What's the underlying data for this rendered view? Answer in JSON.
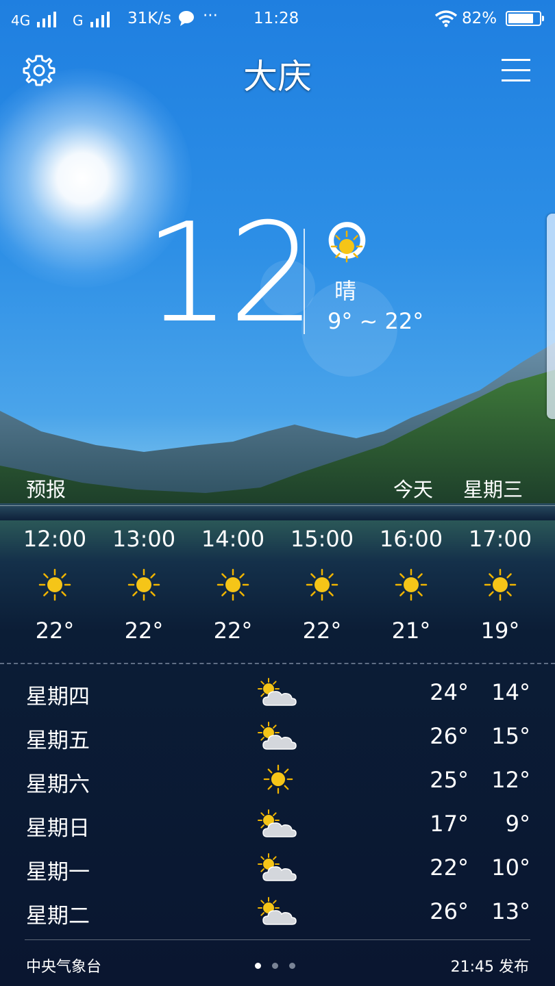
{
  "status_bar": {
    "network1": "4G",
    "network2": "G",
    "speed": "31K/s",
    "more": "···",
    "time": "11:28",
    "battery": "82%",
    "battery_level": 0.82
  },
  "header": {
    "city": "大庆",
    "settings_icon": "gear-icon",
    "menu_icon": "menu-icon"
  },
  "current": {
    "temperature": "12°",
    "condition": "晴",
    "range": "9° ~ 22°",
    "icon": "sun-icon"
  },
  "forecast_header": {
    "label": "预报",
    "today": "今天",
    "weekday": "星期三"
  },
  "hourly": [
    {
      "time": "12:00",
      "temp": "22°",
      "icon": "sun-icon"
    },
    {
      "time": "13:00",
      "temp": "22°",
      "icon": "sun-icon"
    },
    {
      "time": "14:00",
      "temp": "22°",
      "icon": "sun-icon"
    },
    {
      "time": "15:00",
      "temp": "22°",
      "icon": "sun-icon"
    },
    {
      "time": "16:00",
      "temp": "21°",
      "icon": "sun-icon"
    },
    {
      "time": "17:00",
      "temp": "19°",
      "icon": "sun-icon"
    }
  ],
  "daily": [
    {
      "day": "星期四",
      "icon": "partly-cloudy-icon",
      "high": "24°",
      "low": "14°"
    },
    {
      "day": "星期五",
      "icon": "partly-cloudy-icon",
      "high": "26°",
      "low": "15°"
    },
    {
      "day": "星期六",
      "icon": "sun-icon",
      "high": "25°",
      "low": "12°"
    },
    {
      "day": "星期日",
      "icon": "partly-cloudy-icon",
      "high": "17°",
      "low": "9°"
    },
    {
      "day": "星期一",
      "icon": "partly-cloudy-icon",
      "high": "22°",
      "low": "10°"
    },
    {
      "day": "星期二",
      "icon": "partly-cloudy-icon",
      "high": "26°",
      "low": "13°"
    }
  ],
  "footer": {
    "source": "中央气象台",
    "published": "21:45 发布",
    "page_count": 3,
    "active_page": 0
  },
  "colors": {
    "sun": "#f5c518",
    "sun_rays": "#f0b400",
    "cloud": "#d4d7dc"
  }
}
